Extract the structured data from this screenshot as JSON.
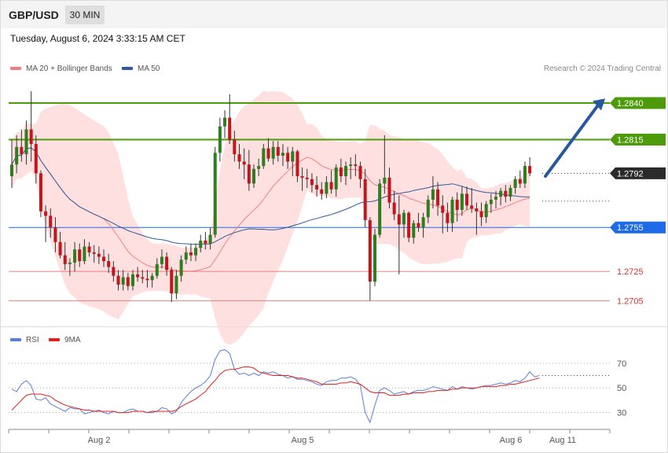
{
  "header": {
    "symbol": "GBP/USD",
    "timeframe": "30 MIN",
    "datetime": "Tuesday, August 6, 2024 3:33:15 AM CET"
  },
  "legend": {
    "ma20": {
      "label": "MA 20 + Bollinger Bands",
      "color": "#f08080"
    },
    "ma50": {
      "label": "MA 50",
      "color": "#2f5a9a"
    },
    "rsi": {
      "label": "RSI",
      "color": "#5b7fd6"
    },
    "rsi_ma": {
      "label": "9MA",
      "color": "#dd2222"
    },
    "credit": "Research © 2024 Trading Central"
  },
  "chart_data": [
    {
      "type": "candlestick",
      "ylim": [
        1.2688,
        1.2862
      ],
      "levels": [
        {
          "value": "1.2840",
          "style": "resistance",
          "color": "#4d9a0a"
        },
        {
          "value": "1.2815",
          "style": "resistance",
          "color": "#4d9a0a"
        },
        {
          "value": "1.2792",
          "style": "last",
          "color": "#2b2b2b"
        },
        {
          "value": "1.2755",
          "style": "pivot",
          "color": "#1f6ae6"
        },
        {
          "value": "1.2725",
          "style": "support",
          "color": "#e88080"
        },
        {
          "value": "1.2705",
          "style": "support",
          "color": "#e88080"
        }
      ],
      "reference_line": 1.2773,
      "forecast_arrow": {
        "from": 1.279,
        "to": 1.2843
      },
      "x_ticks": [
        "Aug 2",
        "Aug 5",
        "Aug 6",
        "Aug 11"
      ],
      "candles": [
        [
          1.279,
          1.2815,
          1.2782,
          1.2798
        ],
        [
          1.2798,
          1.2818,
          1.2792,
          1.281
        ],
        [
          1.281,
          1.2822,
          1.28,
          1.2805
        ],
        [
          1.2805,
          1.2828,
          1.2798,
          1.2822
        ],
        [
          1.2822,
          1.2848,
          1.28,
          1.2812
        ],
        [
          1.2812,
          1.2818,
          1.2785,
          1.2792
        ],
        [
          1.2792,
          1.2794,
          1.2762,
          1.2766
        ],
        [
          1.2766,
          1.277,
          1.2745,
          1.2763
        ],
        [
          1.2763,
          1.2768,
          1.2748,
          1.2755
        ],
        [
          1.2755,
          1.2762,
          1.2738,
          1.2745
        ],
        [
          1.2745,
          1.2752,
          1.2734,
          1.2736
        ],
        [
          1.2736,
          1.2745,
          1.2726,
          1.273
        ],
        [
          1.273,
          1.2734,
          1.2722,
          1.2731
        ],
        [
          1.2731,
          1.2745,
          1.2725,
          1.274
        ],
        [
          1.274,
          1.2744,
          1.2728,
          1.2732
        ],
        [
          1.2732,
          1.2747,
          1.273,
          1.2742
        ],
        [
          1.2742,
          1.2745,
          1.2735,
          1.2738
        ],
        [
          1.2738,
          1.2743,
          1.2731,
          1.2737
        ],
        [
          1.2737,
          1.2742,
          1.273,
          1.2735
        ],
        [
          1.2735,
          1.274,
          1.2728,
          1.2732
        ],
        [
          1.2732,
          1.2737,
          1.2724,
          1.2728
        ],
        [
          1.2728,
          1.2732,
          1.2718,
          1.2722
        ],
        [
          1.2722,
          1.2726,
          1.2712,
          1.2716
        ],
        [
          1.2716,
          1.2726,
          1.2712,
          1.2721
        ],
        [
          1.2721,
          1.2724,
          1.2712,
          1.2715
        ],
        [
          1.2715,
          1.2726,
          1.2712,
          1.2723
        ],
        [
          1.2723,
          1.2728,
          1.2718,
          1.2721
        ],
        [
          1.2721,
          1.2726,
          1.2717,
          1.272
        ],
        [
          1.272,
          1.2726,
          1.2714,
          1.2719
        ],
        [
          1.2719,
          1.2724,
          1.2714,
          1.2722
        ],
        [
          1.2722,
          1.2734,
          1.272,
          1.273
        ],
        [
          1.273,
          1.274,
          1.2727,
          1.2735
        ],
        [
          1.2735,
          1.2738,
          1.2722,
          1.2726
        ],
        [
          1.2726,
          1.2728,
          1.2704,
          1.271
        ],
        [
          1.271,
          1.2726,
          1.2706,
          1.2722
        ],
        [
          1.2722,
          1.2736,
          1.2718,
          1.2733
        ],
        [
          1.2733,
          1.2742,
          1.273,
          1.2738
        ],
        [
          1.2738,
          1.2744,
          1.2732,
          1.2736
        ],
        [
          1.2736,
          1.2744,
          1.2732,
          1.2741
        ],
        [
          1.2741,
          1.275,
          1.2738,
          1.2746
        ],
        [
          1.2746,
          1.2752,
          1.274,
          1.2744
        ],
        [
          1.2744,
          1.2755,
          1.274,
          1.275
        ],
        [
          1.275,
          1.281,
          1.2748,
          1.2806
        ],
        [
          1.2806,
          1.283,
          1.28,
          1.2824
        ],
        [
          1.2824,
          1.2835,
          1.2816,
          1.283
        ],
        [
          1.283,
          1.2846,
          1.2812,
          1.2815
        ],
        [
          1.2815,
          1.2821,
          1.28,
          1.2805
        ],
        [
          1.2805,
          1.2812,
          1.2795,
          1.28
        ],
        [
          1.28,
          1.2809,
          1.2788,
          1.2798
        ],
        [
          1.2798,
          1.2808,
          1.278,
          1.2785
        ],
        [
          1.2785,
          1.2798,
          1.2782,
          1.2795
        ],
        [
          1.2795,
          1.2802,
          1.279,
          1.2797
        ],
        [
          1.2797,
          1.2812,
          1.2795,
          1.2809
        ],
        [
          1.2809,
          1.2816,
          1.28,
          1.2802
        ],
        [
          1.2802,
          1.2814,
          1.2798,
          1.281
        ],
        [
          1.281,
          1.2814,
          1.28,
          1.2804
        ],
        [
          1.2804,
          1.2812,
          1.2797,
          1.2806
        ],
        [
          1.2806,
          1.281,
          1.2795,
          1.28
        ],
        [
          1.28,
          1.281,
          1.279,
          1.2807
        ],
        [
          1.2807,
          1.2808,
          1.2786,
          1.279
        ],
        [
          1.279,
          1.2796,
          1.278,
          1.2789
        ],
        [
          1.2789,
          1.2795,
          1.2782,
          1.2788
        ],
        [
          1.2788,
          1.2792,
          1.2779,
          1.2784
        ],
        [
          1.2784,
          1.279,
          1.2776,
          1.2781
        ],
        [
          1.2781,
          1.2786,
          1.2774,
          1.2778
        ],
        [
          1.2778,
          1.279,
          1.2775,
          1.2786
        ],
        [
          1.2786,
          1.2794,
          1.2778,
          1.2781
        ],
        [
          1.2781,
          1.2798,
          1.2776,
          1.2796
        ],
        [
          1.2796,
          1.2802,
          1.2786,
          1.279
        ],
        [
          1.279,
          1.28,
          1.2784,
          1.2797
        ],
        [
          1.2797,
          1.2803,
          1.2788,
          1.2798
        ],
        [
          1.2798,
          1.2805,
          1.279,
          1.2797
        ],
        [
          1.2797,
          1.28,
          1.2782,
          1.2788
        ],
        [
          1.2788,
          1.2795,
          1.2755,
          1.276
        ],
        [
          1.276,
          1.2762,
          1.2705,
          1.2718
        ],
        [
          1.2718,
          1.2754,
          1.2715,
          1.275
        ],
        [
          1.275,
          1.2788,
          1.2748,
          1.2785
        ],
        [
          1.2785,
          1.2818,
          1.2778,
          1.2789
        ],
        [
          1.2789,
          1.2796,
          1.2768,
          1.2772
        ],
        [
          1.2772,
          1.278,
          1.276,
          1.2764
        ],
        [
          1.2764,
          1.2777,
          1.2723,
          1.2757
        ],
        [
          1.2757,
          1.2767,
          1.2748,
          1.2765
        ],
        [
          1.2765,
          1.2766,
          1.2745,
          1.2748
        ],
        [
          1.2748,
          1.276,
          1.2744,
          1.2758
        ],
        [
          1.2758,
          1.2765,
          1.2752,
          1.2755
        ],
        [
          1.2755,
          1.2765,
          1.2748,
          1.2762
        ],
        [
          1.2762,
          1.2777,
          1.2758,
          1.2774
        ],
        [
          1.2774,
          1.279,
          1.2768,
          1.2781
        ],
        [
          1.2781,
          1.2786,
          1.2763,
          1.277
        ],
        [
          1.277,
          1.2777,
          1.2751,
          1.2765
        ],
        [
          1.2765,
          1.2772,
          1.2752,
          1.2758
        ],
        [
          1.2758,
          1.2776,
          1.2752,
          1.2774
        ],
        [
          1.2774,
          1.2779,
          1.2759,
          1.2767
        ],
        [
          1.2767,
          1.2783,
          1.2763,
          1.2778
        ],
        [
          1.2778,
          1.2783,
          1.2767,
          1.277
        ],
        [
          1.277,
          1.2782,
          1.2765,
          1.2768
        ],
        [
          1.2768,
          1.2772,
          1.275,
          1.2766
        ],
        [
          1.2766,
          1.2772,
          1.2756,
          1.2762
        ],
        [
          1.2762,
          1.2773,
          1.2758,
          1.2771
        ],
        [
          1.2771,
          1.2778,
          1.2765,
          1.2774
        ],
        [
          1.2774,
          1.278,
          1.2768,
          1.2776
        ],
        [
          1.2776,
          1.2782,
          1.277,
          1.278
        ],
        [
          1.278,
          1.2784,
          1.2772,
          1.2776
        ],
        [
          1.2776,
          1.2784,
          1.2773,
          1.2782
        ],
        [
          1.2782,
          1.279,
          1.2778,
          1.2788
        ],
        [
          1.2788,
          1.2794,
          1.2782,
          1.2785
        ],
        [
          1.2785,
          1.28,
          1.2782,
          1.2797
        ],
        [
          1.2797,
          1.2803,
          1.279,
          1.2792
        ]
      ]
    },
    {
      "type": "line",
      "title": "RSI",
      "ylim": [
        17,
        82
      ],
      "y_ticks": [
        70,
        50,
        30
      ],
      "series": [
        {
          "name": "RSI",
          "values": [
            49,
            47,
            53,
            56,
            52,
            41,
            40,
            42,
            37,
            35,
            33,
            31,
            34,
            33,
            33,
            29,
            30,
            31,
            32,
            30,
            29,
            31,
            30,
            30,
            32,
            33,
            31,
            31,
            30,
            30,
            31,
            34,
            33,
            29,
            31,
            38,
            43,
            47,
            50,
            52,
            55,
            60,
            73,
            80,
            81,
            78,
            65,
            61,
            62,
            60,
            62,
            60,
            63,
            62,
            63,
            61,
            60,
            58,
            59,
            57,
            57,
            56,
            55,
            53,
            52,
            55,
            56,
            56,
            58,
            58,
            59,
            57,
            52,
            30,
            22,
            36,
            48,
            50,
            48,
            45,
            46,
            47,
            45,
            47,
            48,
            48,
            49,
            51,
            50,
            49,
            48,
            51,
            49,
            51,
            50,
            49,
            50,
            51,
            52,
            52,
            53,
            54,
            53,
            54,
            56,
            55,
            58,
            63,
            59,
            60
          ]
        },
        {
          "name": "9MA",
          "values": [
            32,
            36,
            40,
            44,
            45,
            45,
            45,
            44,
            43,
            40,
            38,
            36,
            35,
            34,
            33,
            32,
            32,
            31,
            31,
            31,
            31,
            31,
            30,
            30,
            30,
            31,
            31,
            31,
            30,
            31,
            31,
            31,
            31,
            31,
            32,
            35,
            37,
            39,
            41,
            44,
            47,
            52,
            56,
            61,
            64,
            65,
            65,
            66,
            67,
            67,
            66,
            63,
            62,
            61,
            60,
            60,
            60,
            60,
            59,
            58,
            58,
            57,
            56,
            55,
            53,
            53,
            53,
            53,
            54,
            54,
            55,
            54,
            53,
            50,
            47,
            46,
            46,
            46,
            44,
            44,
            44,
            45,
            45,
            46,
            46,
            46,
            47,
            47,
            48,
            48,
            48,
            49,
            49,
            50,
            50,
            50,
            50,
            51,
            51,
            51,
            51,
            52,
            52,
            53,
            53,
            54,
            55,
            56,
            57,
            58
          ]
        }
      ]
    }
  ]
}
